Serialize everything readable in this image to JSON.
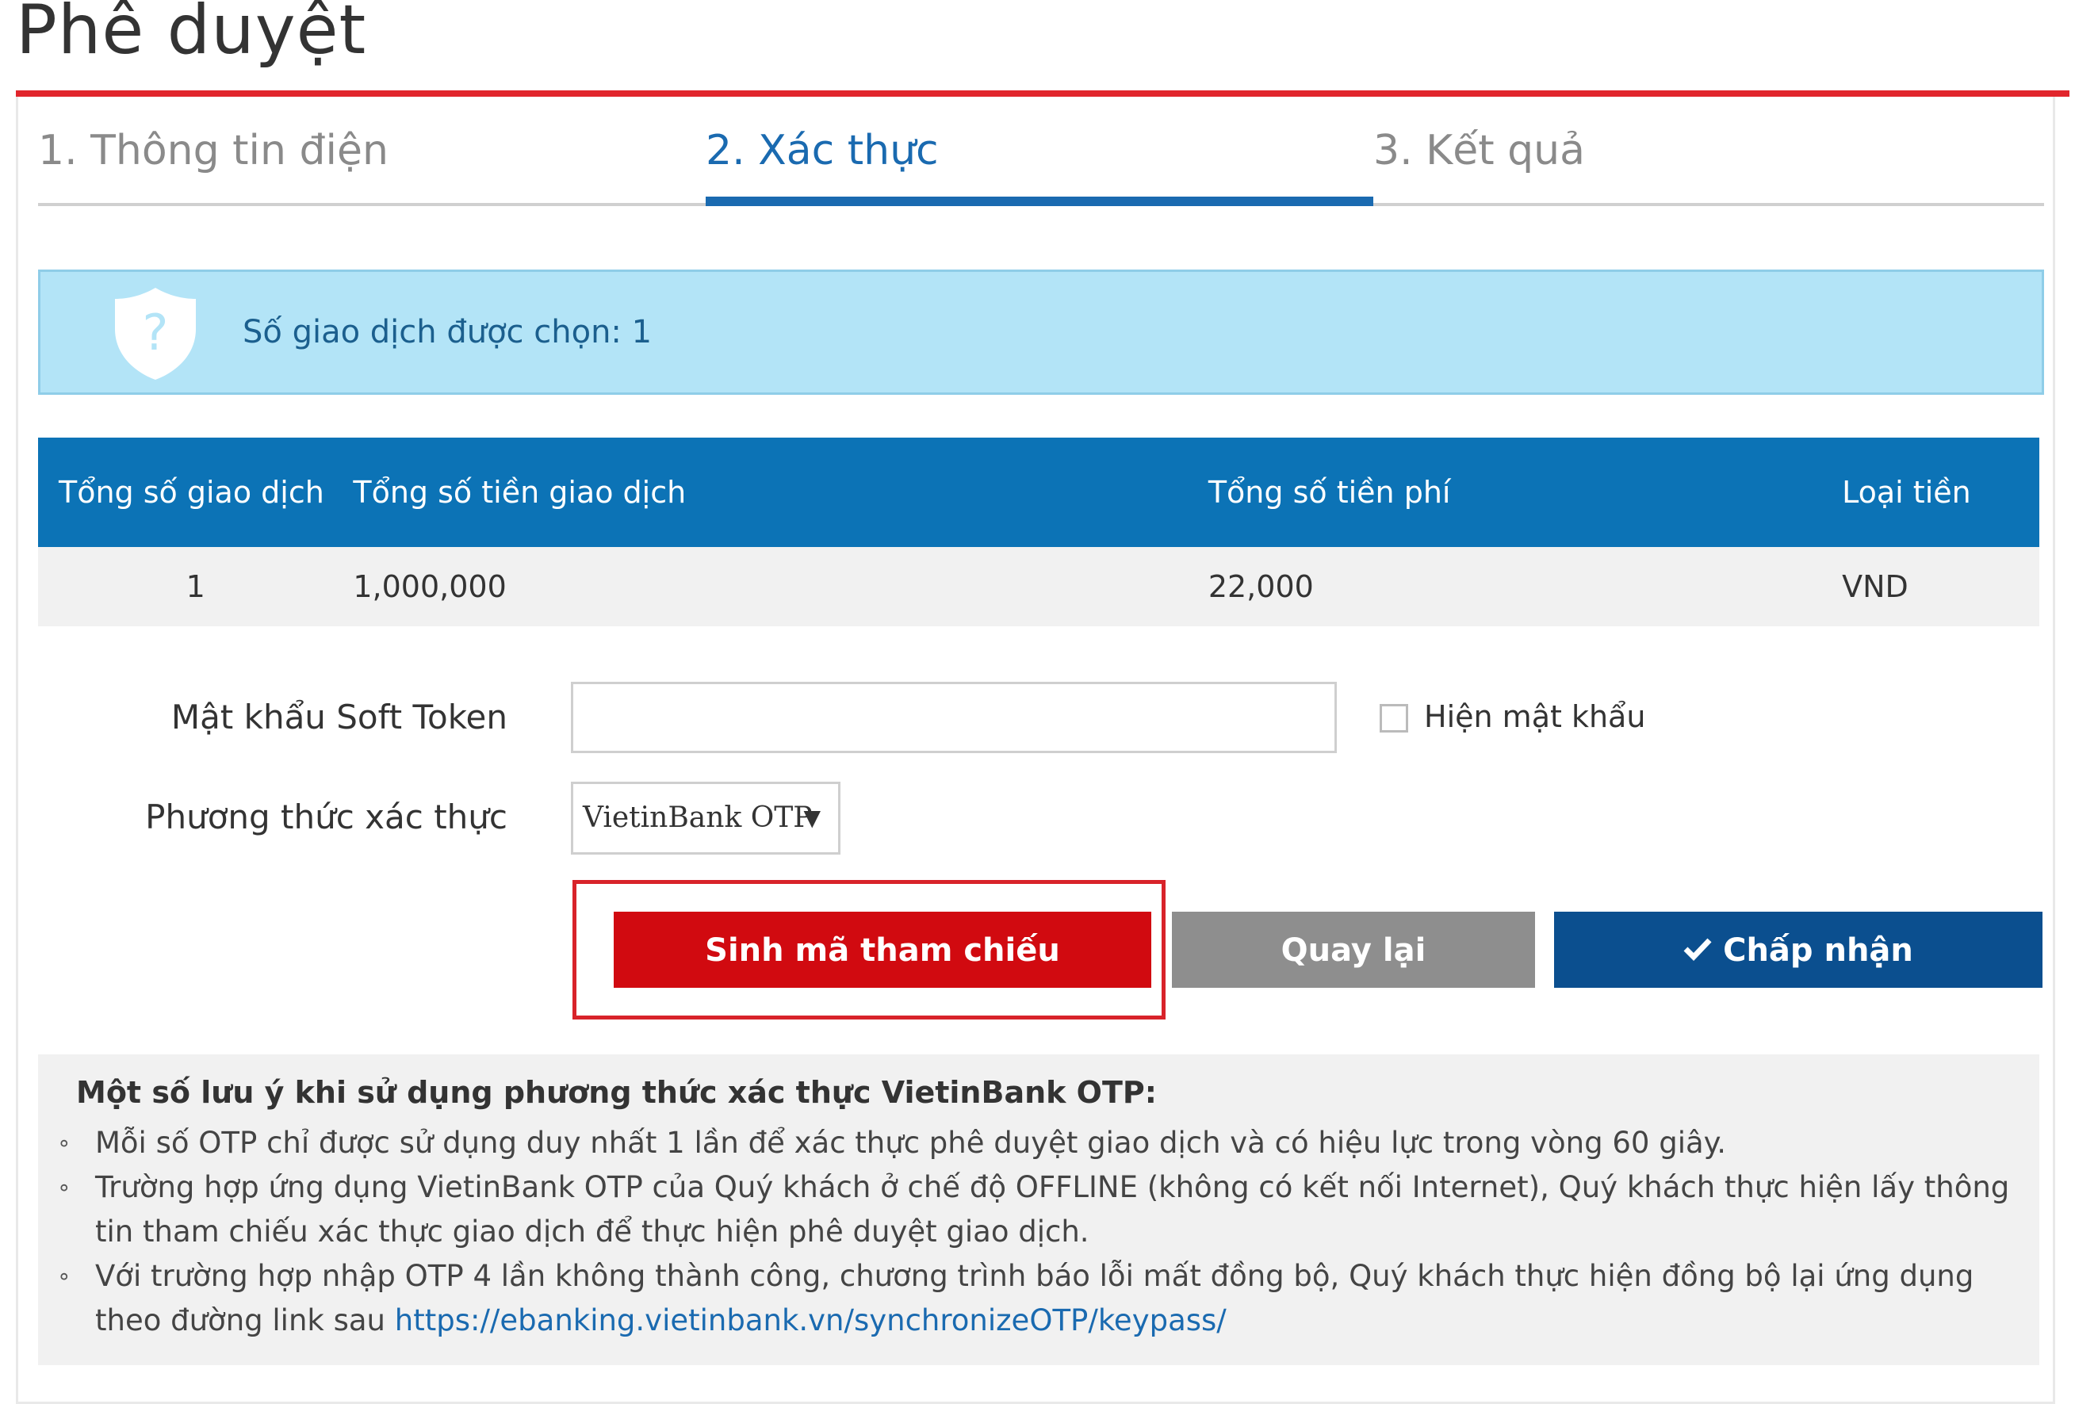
{
  "page": {
    "title": "Phê duyệt"
  },
  "steps": [
    {
      "label": "1. Thông tin điện",
      "active": false
    },
    {
      "label": "2. Xác thực",
      "active": true
    },
    {
      "label": "3. Kết quả",
      "active": false
    }
  ],
  "alert": {
    "icon": "shield-question-icon",
    "text": "Số giao dịch được chọn: 1"
  },
  "summary_table": {
    "headers": [
      "Tổng số giao dịch",
      "Tổng số tiền giao dịch",
      "Tổng số tiền phí",
      "Loại tiền"
    ],
    "row": [
      "1",
      "1,000,000",
      "22,000",
      "VND"
    ]
  },
  "form": {
    "token_label": "Mật khẩu Soft Token",
    "token_value": "",
    "show_password_label": "Hiện mật khẩu",
    "show_password_checked": false,
    "method_label": "Phương thức xác thực",
    "method_selected": "VietinBank OTP",
    "method_caret": "▼"
  },
  "buttons": {
    "generate_reference": "Sinh mã tham chiếu",
    "back": "Quay lại",
    "accept": "Chấp nhận",
    "accept_icon": "check-icon"
  },
  "notes": {
    "title": "Một số lưu ý khi sử dụng phương thức xác thực VietinBank OTP:",
    "bullet": "∘",
    "items": [
      "Mỗi số OTP chỉ được sử dụng duy nhất 1 lần để xác thực phê duyệt giao dịch và có hiệu lực trong vòng 60 giây.",
      "Trường hợp ứng dụng VietinBank OTP của Quý khách ở chế độ OFFLINE (không có kết nối Internet), Quý khách thực hiện lấy thông tin tham chiếu xác thực giao dịch để thực hiện phê duyệt giao dịch.",
      "Với trường hợp nhập OTP 4 lần không thành công, chương trình báo lỗi mất đồng bộ, Quý khách thực hiện đồng bộ lại ứng dụng theo đường link sau"
    ],
    "link": "https://ebanking.vietinbank.vn/synchronizeOTP/keypass/"
  },
  "colors": {
    "accent_red": "#e1252c",
    "step_active_blue": "#1a6ab0",
    "table_header_blue": "#0c73b6",
    "alert_bg": "#b3e4f7",
    "button_red": "#d10a10",
    "button_gray": "#8e8e8e",
    "button_navy": "#0b4f8f"
  }
}
